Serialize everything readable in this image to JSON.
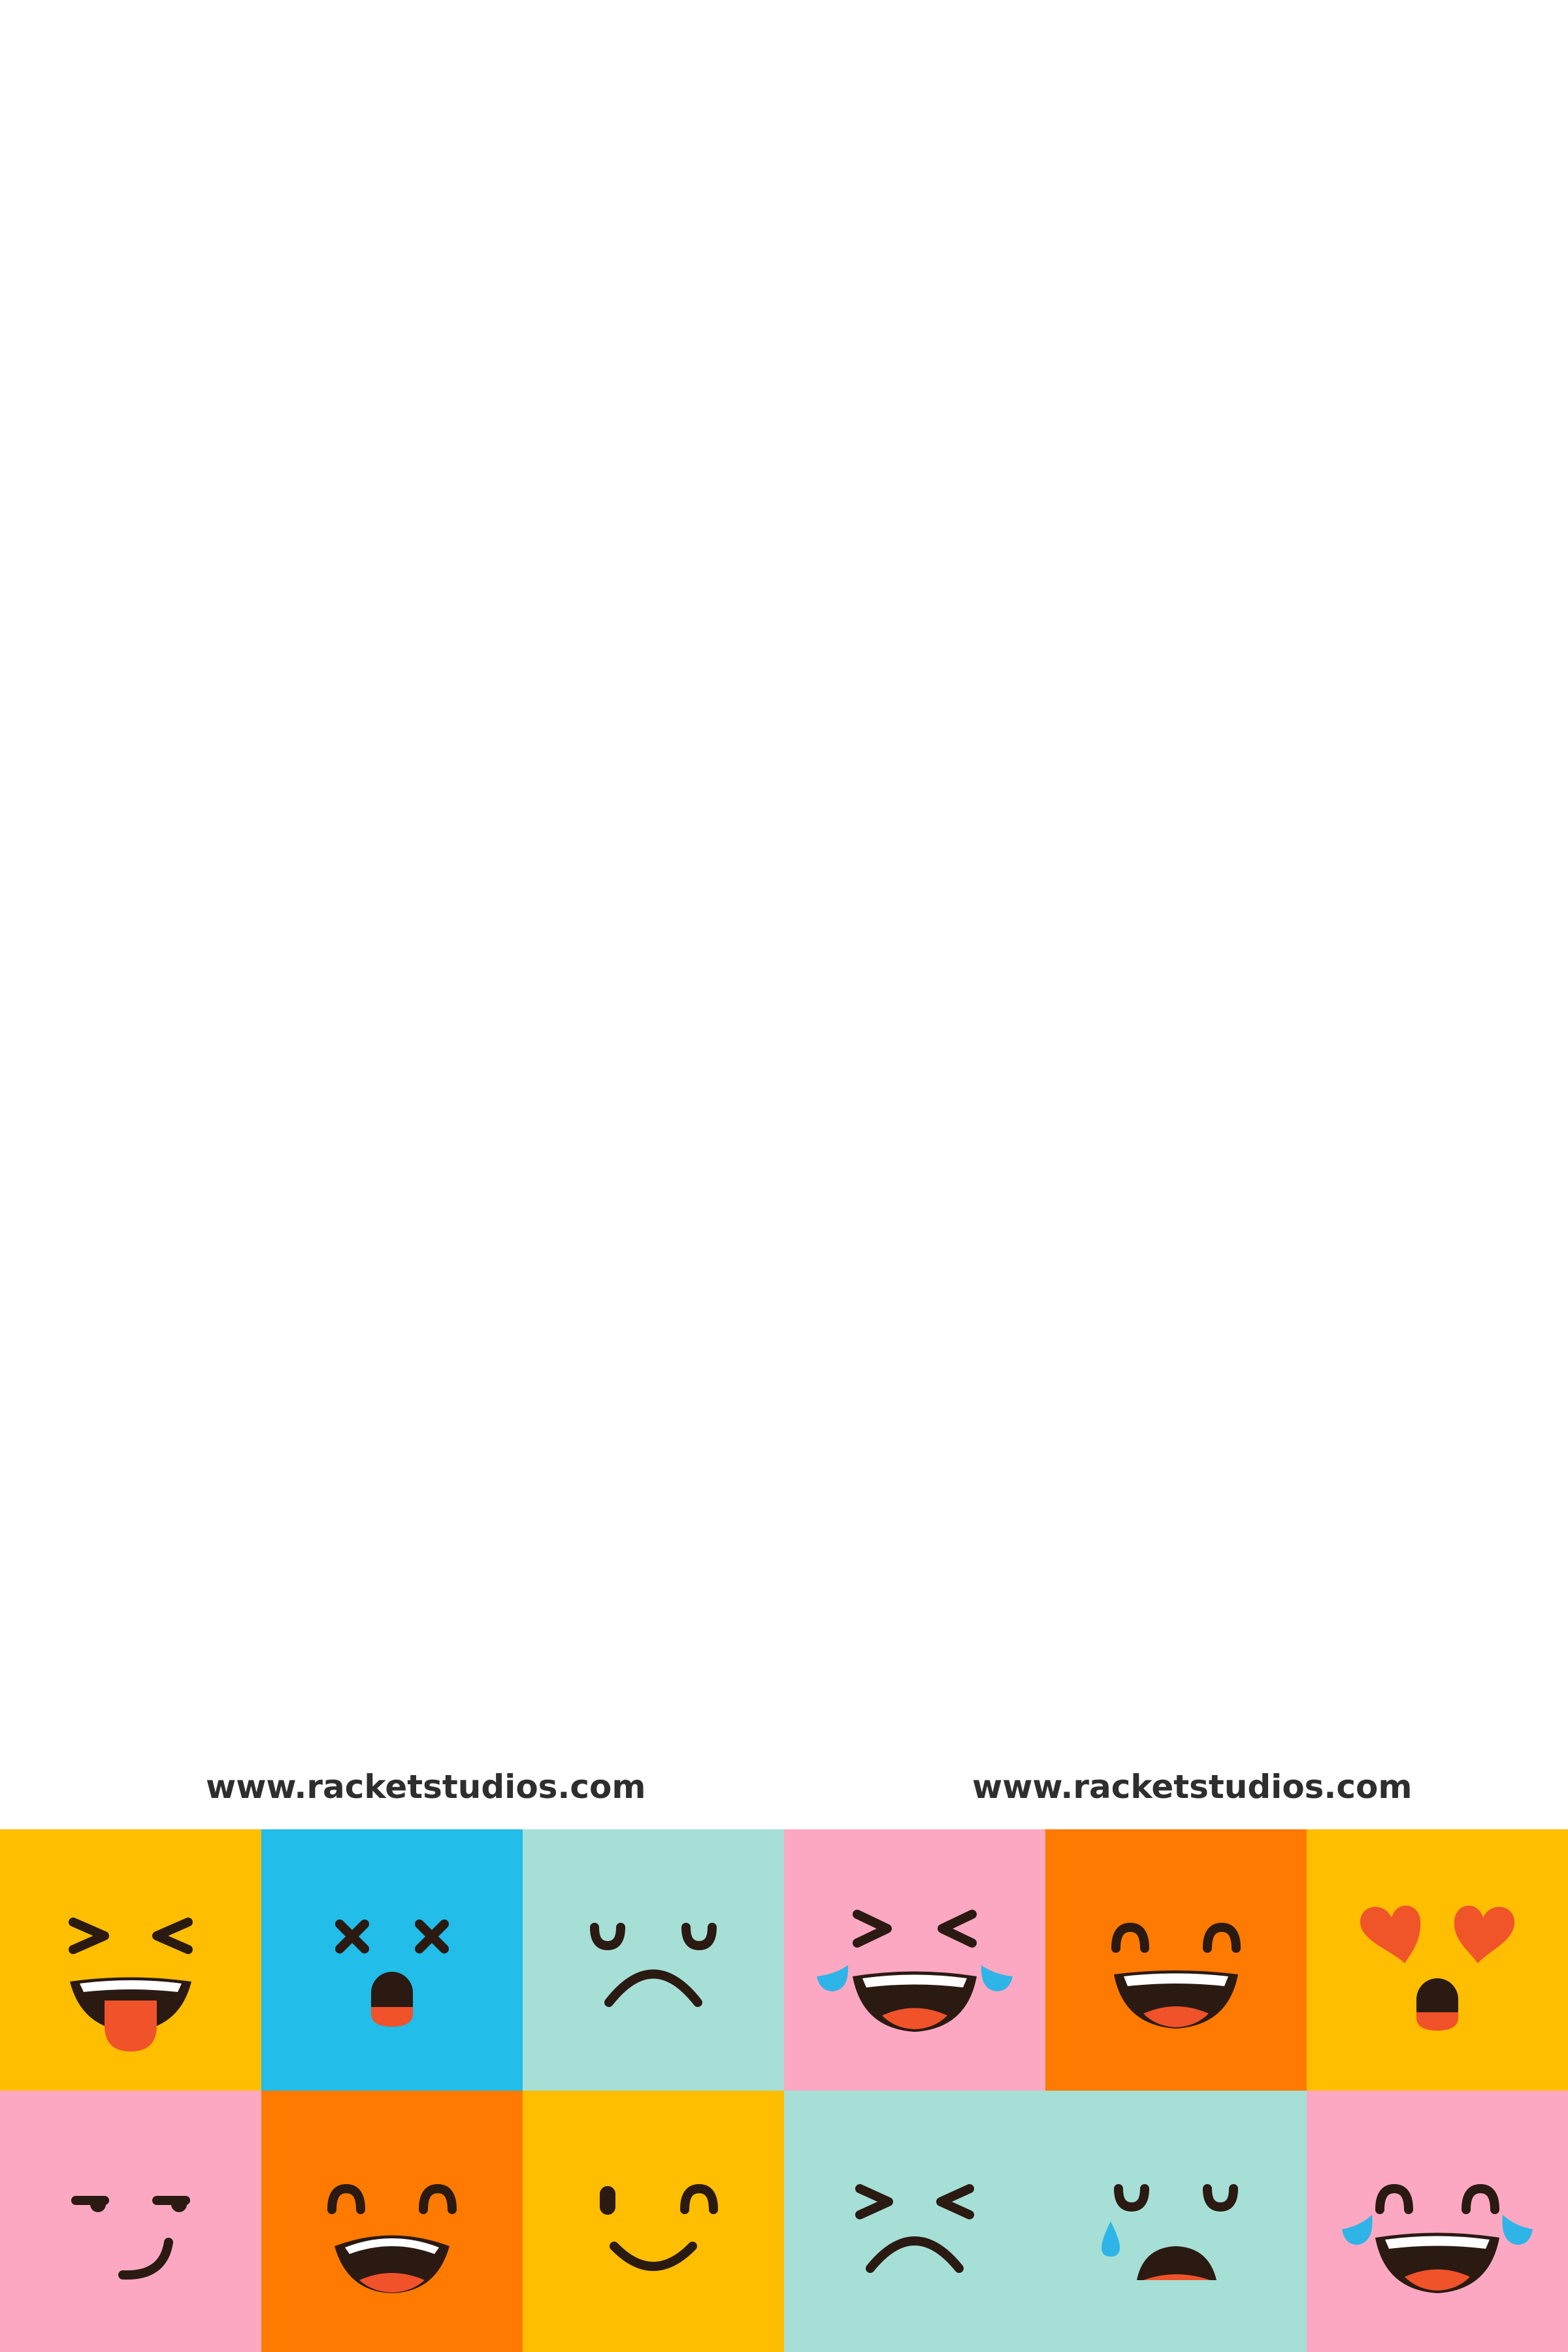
{
  "footer": {
    "url_left": "www.racketstudios.com",
    "url_right": "www.racketstudios.com"
  },
  "colors": {
    "yellow": "#FFBE00",
    "blue": "#22BDE8",
    "mint": "#A6DFD6",
    "pink": "#FDA8C2",
    "orange": "#FF7A00",
    "ink": "#2A1A12",
    "tongue": "#F0522A",
    "tear": "#2FB4E8",
    "heart": "#F0552A"
  },
  "tiles": [
    {
      "row": 1,
      "col": 1,
      "bg": "yellow",
      "icon": "tongue-out-squint-face-icon"
    },
    {
      "row": 1,
      "col": 2,
      "bg": "blue",
      "icon": "dizzy-face-icon"
    },
    {
      "row": 1,
      "col": 3,
      "bg": "mint",
      "icon": "sad-face-icon"
    },
    {
      "row": 1,
      "col": 4,
      "bg": "pink",
      "icon": "tears-of-joy-face-icon"
    },
    {
      "row": 1,
      "col": 5,
      "bg": "orange",
      "icon": "grinning-face-icon"
    },
    {
      "row": 1,
      "col": 6,
      "bg": "yellow",
      "icon": "heart-eyes-face-icon"
    },
    {
      "row": 2,
      "col": 1,
      "bg": "pink",
      "icon": "smirk-face-icon"
    },
    {
      "row": 2,
      "col": 2,
      "bg": "orange",
      "icon": "laughing-face-icon"
    },
    {
      "row": 2,
      "col": 3,
      "bg": "yellow",
      "icon": "wink-smile-face-icon"
    },
    {
      "row": 2,
      "col": 4,
      "bg": "mint",
      "icon": "frowning-squint-face-icon"
    },
    {
      "row": 2,
      "col": 5,
      "bg": "mint",
      "icon": "crying-face-icon"
    },
    {
      "row": 2,
      "col": 6,
      "bg": "pink",
      "icon": "happy-tears-face-icon"
    }
  ]
}
